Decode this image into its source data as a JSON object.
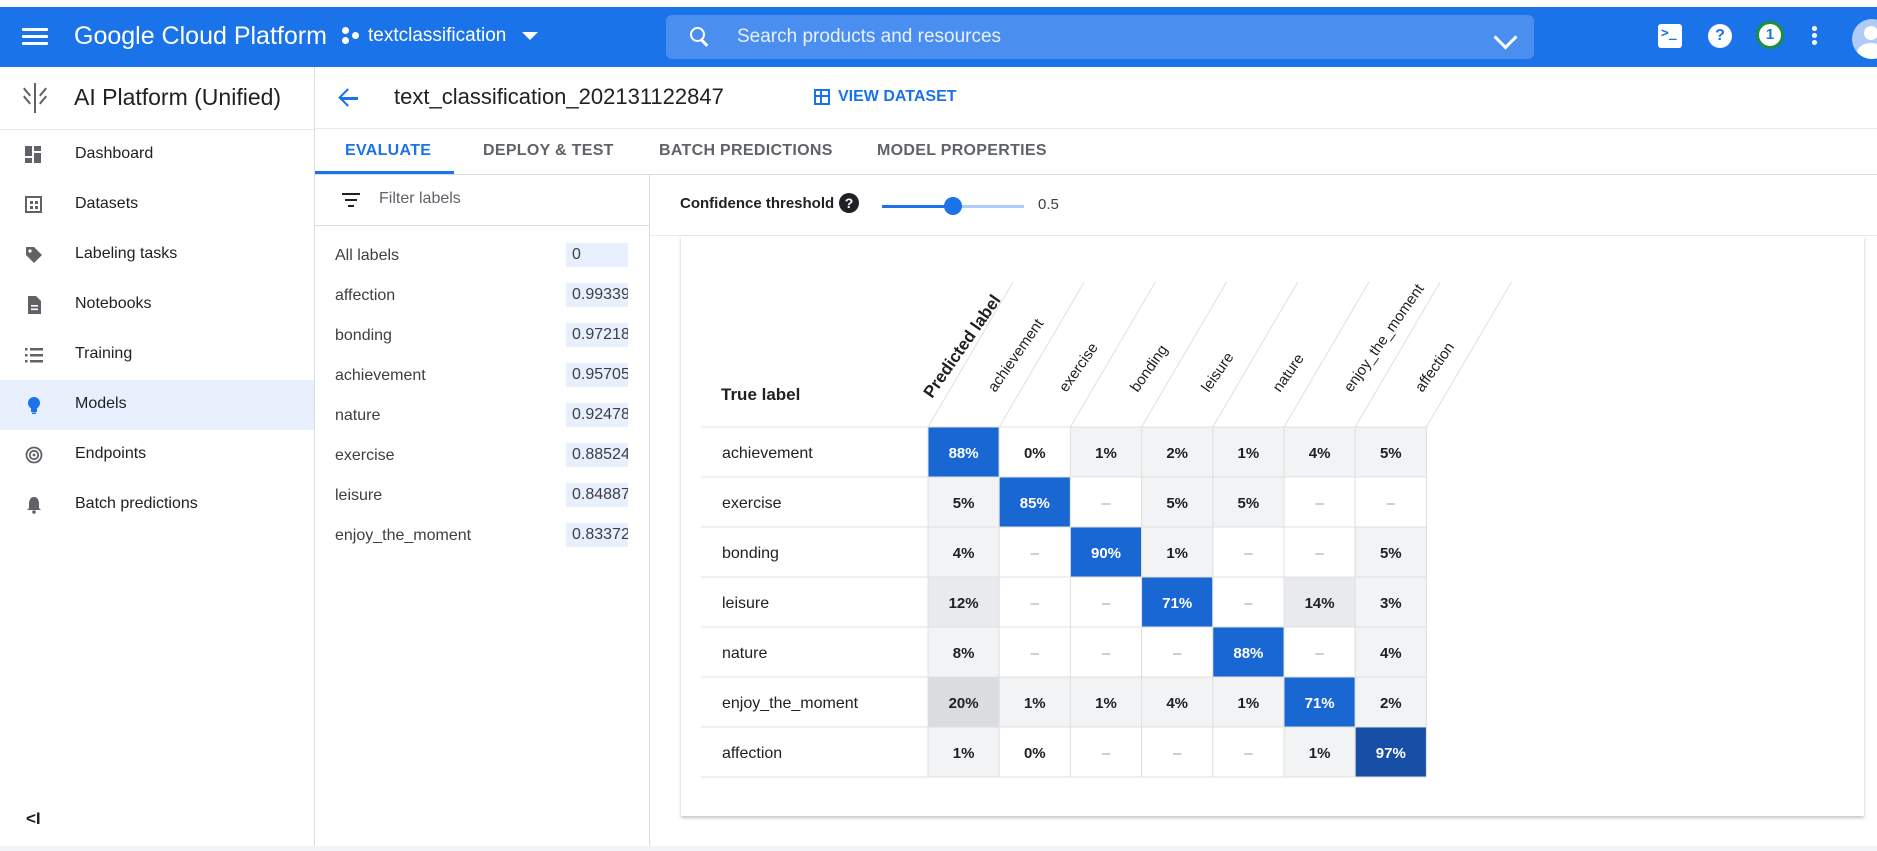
{
  "topbar": {
    "brand": "Google Cloud Platform",
    "project": "textclassification",
    "search_placeholder": "Search products and resources",
    "notification_count": "1",
    "help_glyph": "?",
    "icons": [
      "menu-icon",
      "project-icon",
      "search-icon",
      "cloud-shell-icon",
      "help-icon",
      "more-vert-icon",
      "avatar"
    ]
  },
  "sidebar": {
    "title": "AI Platform (Unified)",
    "collapse_glyph": "<I",
    "items": [
      {
        "label": "Dashboard",
        "icon": "dashboard-icon",
        "active": false
      },
      {
        "label": "Datasets",
        "icon": "datasets-icon",
        "active": false
      },
      {
        "label": "Labeling tasks",
        "icon": "label-tag-icon",
        "active": false
      },
      {
        "label": "Notebooks",
        "icon": "notebook-icon",
        "active": false
      },
      {
        "label": "Training",
        "icon": "training-list-icon",
        "active": false
      },
      {
        "label": "Models",
        "icon": "lightbulb-icon",
        "active": true
      },
      {
        "label": "Endpoints",
        "icon": "endpoints-icon",
        "active": false
      },
      {
        "label": "Batch predictions",
        "icon": "bell-icon",
        "active": false
      }
    ]
  },
  "header": {
    "model_title": "text_classification_202131122847",
    "view_dataset": "VIEW DATASET"
  },
  "tabs": [
    {
      "label": "EVALUATE",
      "active": true
    },
    {
      "label": "DEPLOY & TEST",
      "active": false
    },
    {
      "label": "BATCH PREDICTIONS",
      "active": false
    },
    {
      "label": "MODEL PROPERTIES",
      "active": false
    }
  ],
  "labels_panel": {
    "filter_placeholder": "Filter labels",
    "rows": [
      {
        "name": "All labels",
        "value": "0"
      },
      {
        "name": "affection",
        "value": "0.99339"
      },
      {
        "name": "bonding",
        "value": "0.97218"
      },
      {
        "name": "achievement",
        "value": "0.95705"
      },
      {
        "name": "nature",
        "value": "0.92478"
      },
      {
        "name": "exercise",
        "value": "0.88524"
      },
      {
        "name": "leisure",
        "value": "0.84887"
      },
      {
        "name": "enjoy_the_moment",
        "value": "0.83372"
      }
    ]
  },
  "confidence": {
    "label": "Confidence threshold",
    "help_glyph": "?",
    "value": "0.5",
    "fraction": 0.5
  },
  "confusion_matrix": {
    "true_label_title": "True label",
    "predicted_label_title": "Predicted label",
    "labels": [
      "achievement",
      "exercise",
      "bonding",
      "leisure",
      "nature",
      "enjoy_the_moment",
      "affection"
    ],
    "empty_glyph": "–",
    "cells": [
      [
        88,
        0,
        1,
        2,
        1,
        4,
        5
      ],
      [
        5,
        85,
        null,
        5,
        5,
        null,
        null
      ],
      [
        4,
        null,
        90,
        1,
        null,
        null,
        5
      ],
      [
        12,
        null,
        null,
        71,
        null,
        14,
        3
      ],
      [
        8,
        null,
        null,
        null,
        88,
        null,
        4
      ],
      [
        20,
        1,
        1,
        4,
        1,
        71,
        2
      ],
      [
        1,
        0,
        null,
        null,
        null,
        1,
        97
      ]
    ],
    "colors": {
      "diagonal_high": "#174ea6",
      "diagonal": "#1967d2",
      "off_light": "#f1f3f4",
      "off_mid": "#e8eaed",
      "off_dark": "#dadce0"
    }
  }
}
